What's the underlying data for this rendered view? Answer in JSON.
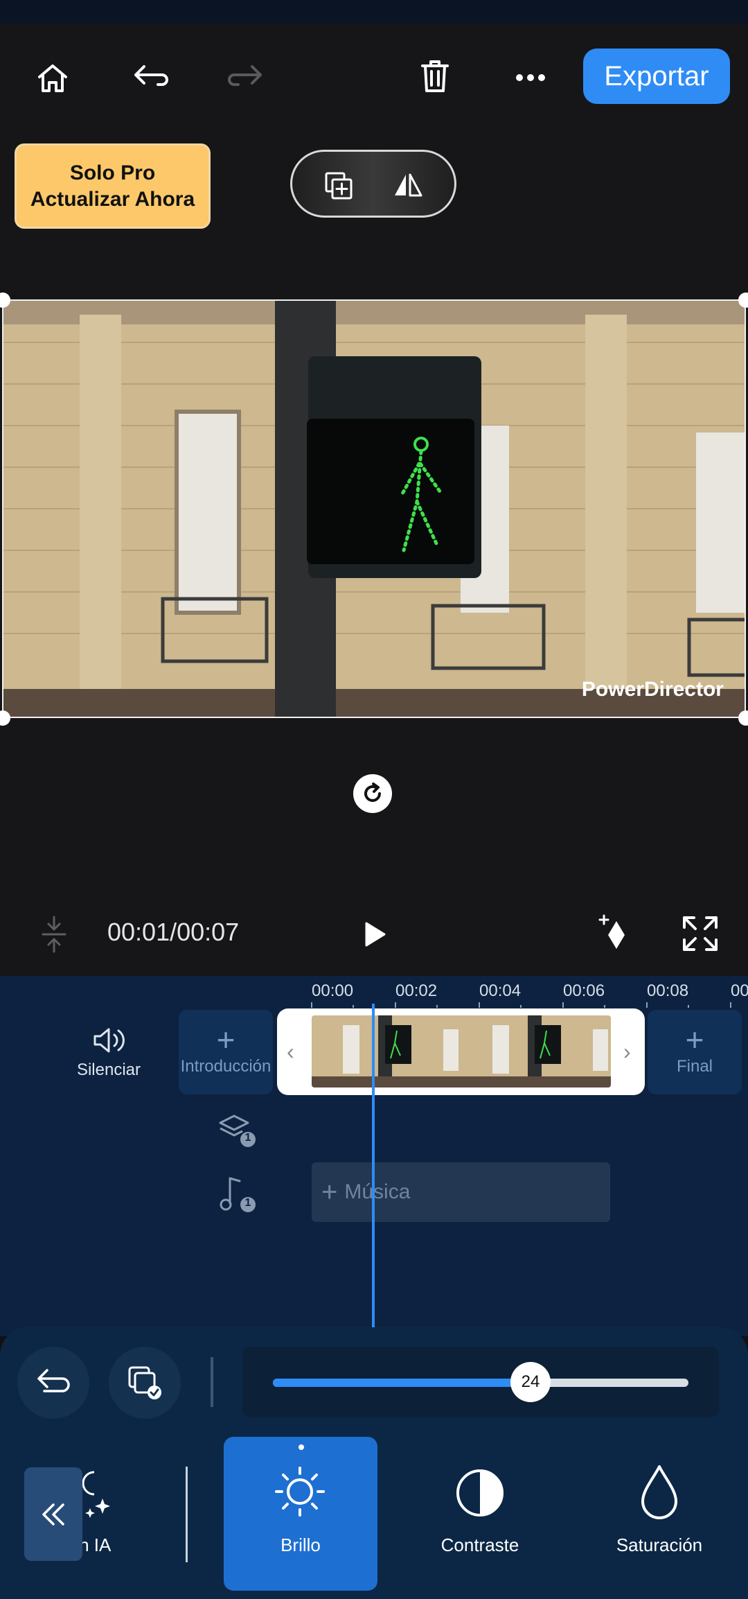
{
  "toolbar": {
    "export_label": "Exportar",
    "pro_line1": "Solo Pro",
    "pro_line2": "Actualizar Ahora"
  },
  "preview": {
    "watermark": "PowerDirector"
  },
  "playback": {
    "timecode": "00:01/00:07"
  },
  "timeline": {
    "ruler": [
      "00:00",
      "00:02",
      "00:04",
      "00:06",
      "00:08",
      "00"
    ],
    "mute_label": "Silenciar",
    "intro_label": "Introducción",
    "final_label": "Final",
    "music_label": "Música",
    "layer_count": "1",
    "music_count": "1"
  },
  "adjust": {
    "slider_value": "24",
    "slider_fraction": 0.62,
    "tabs": [
      "on IA",
      "Brillo",
      "Contraste",
      "Saturación"
    ]
  },
  "colors": {
    "accent": "#2f8cf5",
    "pro_badge": "#fcc869",
    "timeline_bg": "#0d2240",
    "active_tab": "#1e6fd2"
  }
}
